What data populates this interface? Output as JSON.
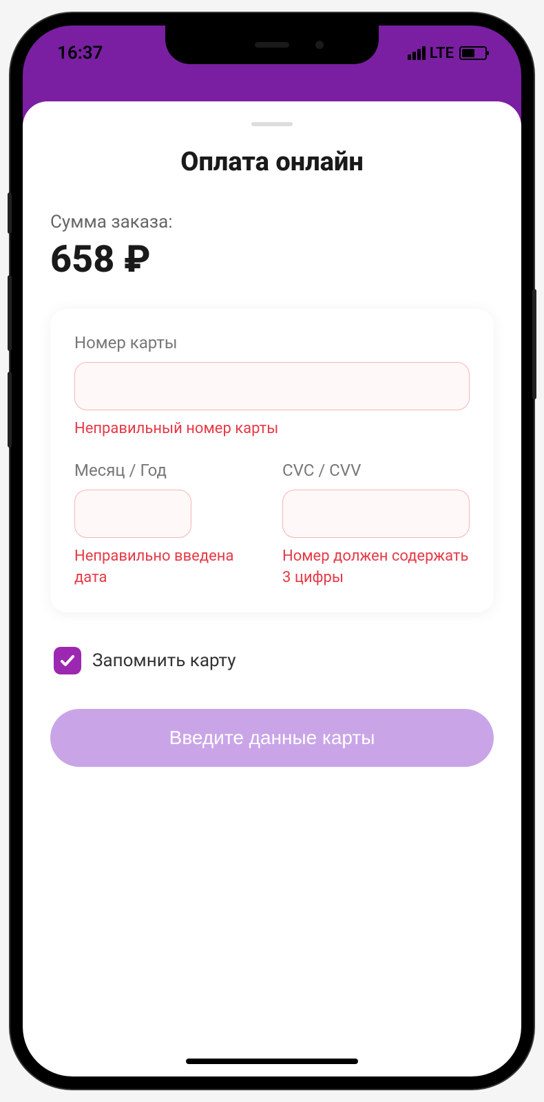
{
  "status_bar": {
    "time": "16:37",
    "network": "LTE"
  },
  "sheet": {
    "title": "Оплата онлайн"
  },
  "order": {
    "label": "Сумма заказа:",
    "amount": "658 ₽"
  },
  "form": {
    "card_number": {
      "label": "Номер карты",
      "error": "Неправильный номер карты"
    },
    "expiry": {
      "label": "Месяц / Год",
      "error": "Неправильно введена дата"
    },
    "cvc": {
      "label": "CVC / CVV",
      "error": "Номер должен содержать 3 цифры"
    }
  },
  "remember": {
    "label": "Запомнить карту",
    "checked": true
  },
  "submit": {
    "label": "Введите данные карты"
  }
}
